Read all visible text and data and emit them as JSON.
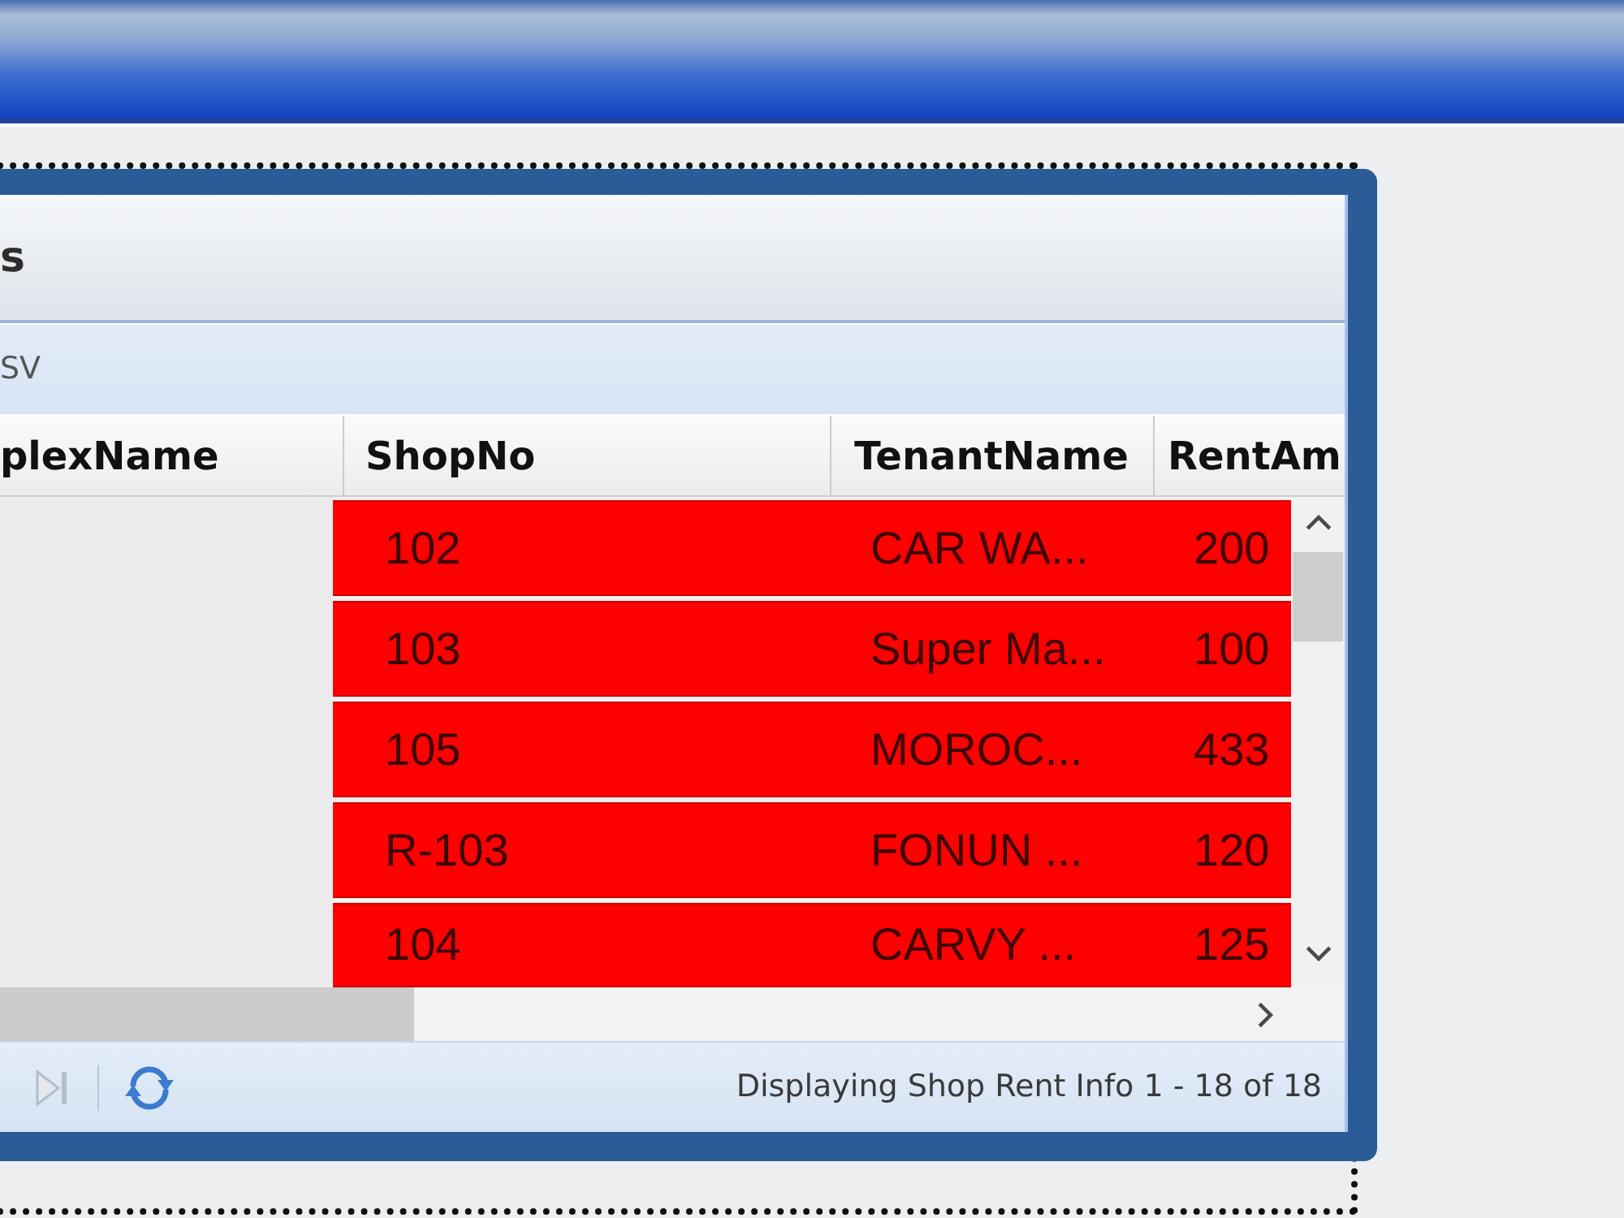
{
  "panel": {
    "title": "s",
    "toolbar": {
      "buttons": [
        "SV"
      ]
    },
    "grid": {
      "columns": [
        "plexName",
        "ShopNo",
        "TenantName",
        "RentAm"
      ],
      "rows": [
        {
          "cells": [
            "",
            "102",
            "CAR WA...",
            "200"
          ],
          "highlighted": true
        },
        {
          "cells": [
            "",
            "103",
            "Super Ma...",
            "100"
          ],
          "highlighted": true
        },
        {
          "cells": [
            "",
            "105",
            "MOROC...",
            "433"
          ],
          "highlighted": true
        },
        {
          "cells": [
            "",
            "R-103",
            "FONUN ...",
            "120"
          ],
          "highlighted": true
        },
        {
          "cells": [
            "",
            "104",
            "CARVY ...",
            "125"
          ],
          "highlighted": true
        }
      ]
    },
    "pager": {
      "buttons": [
        {
          "kind": "last",
          "disabled": true
        },
        {
          "kind": "refresh",
          "disabled": false
        }
      ],
      "status": "Displaying Shop Rent Info 1 - 18 of 18"
    }
  }
}
